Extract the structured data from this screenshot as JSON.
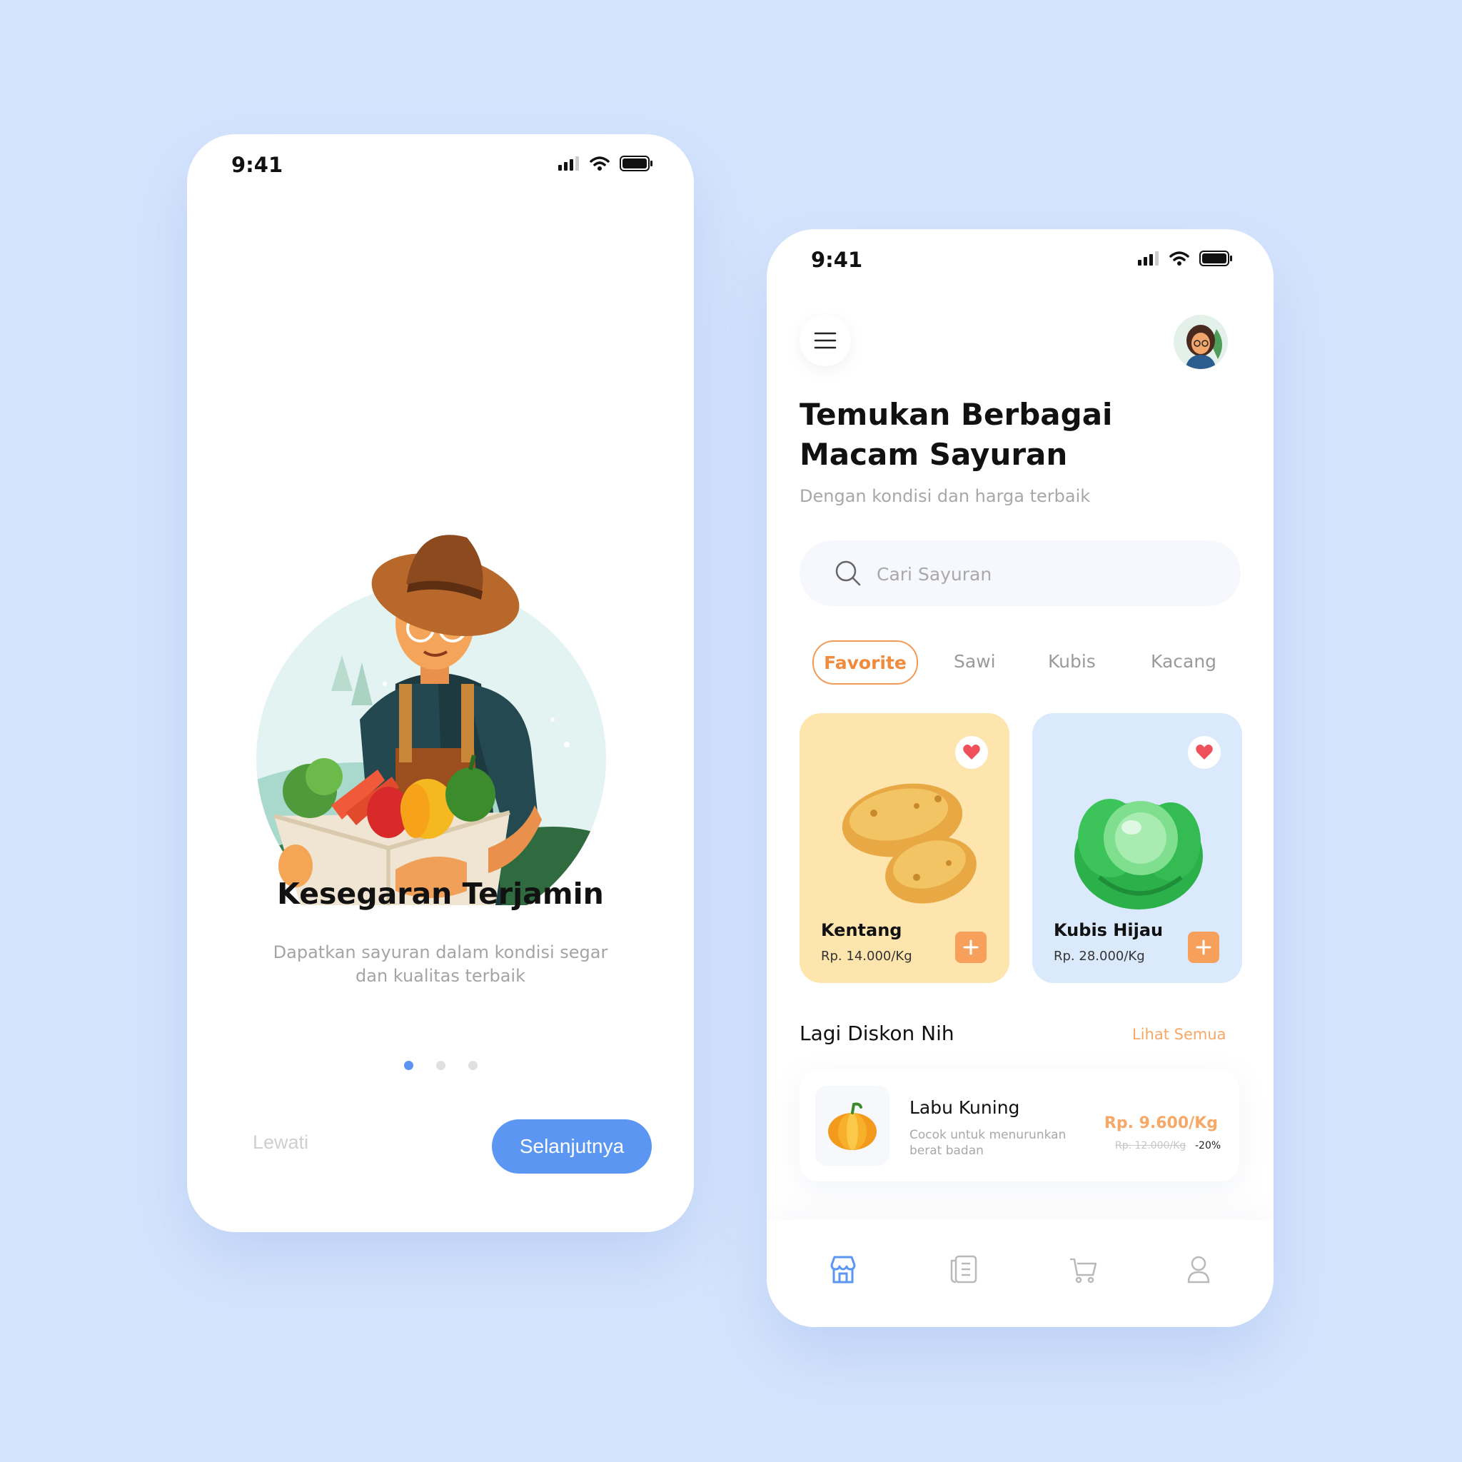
{
  "onboarding": {
    "status_time": "9:41",
    "title": "Kesegaran Terjamin",
    "description": "Dapatkan sayuran dalam kondisi segar dan kualitas terbaik",
    "dots": {
      "total": 3,
      "active_index": 0
    },
    "skip_label": "Lewati",
    "next_label": "Selanjutnya"
  },
  "home": {
    "status_time": "9:41",
    "title": "Temukan Berbagai Macam Sayuran",
    "subtitle": "Dengan kondisi dan harga terbaik",
    "search": {
      "placeholder": "Cari Sayuran"
    },
    "tabs": [
      {
        "label": "Favorite",
        "active": true
      },
      {
        "label": "Sawi",
        "active": false
      },
      {
        "label": "Kubis",
        "active": false
      },
      {
        "label": "Kacang",
        "active": false
      }
    ],
    "products": [
      {
        "name": "Kentang",
        "price": "Rp. 14.000/Kg",
        "favorite": true,
        "card_color": "#fde5ad"
      },
      {
        "name": "Kubis Hijau",
        "price": "Rp. 28.000/Kg",
        "favorite": true,
        "card_color": "#dbe9fd"
      }
    ],
    "discount_section": {
      "title": "Lagi Diskon Nih",
      "see_all": "Lihat Semua",
      "item": {
        "name": "Labu Kuning",
        "description": "Cocok untuk menurunkan berat badan",
        "price": "Rp. 9.600/Kg",
        "old_price": "Rp. 12.000/Kg",
        "discount": "-20%"
      }
    },
    "bottom_nav": [
      {
        "icon": "store-icon",
        "active": true
      },
      {
        "icon": "receipt-icon",
        "active": false
      },
      {
        "icon": "cart-icon",
        "active": false
      },
      {
        "icon": "profile-icon",
        "active": false
      }
    ]
  },
  "colors": {
    "background": "#d5e4fd",
    "primary_blue": "#5b96f3",
    "accent_orange": "#f39b57",
    "heart_red": "#f0505a"
  }
}
